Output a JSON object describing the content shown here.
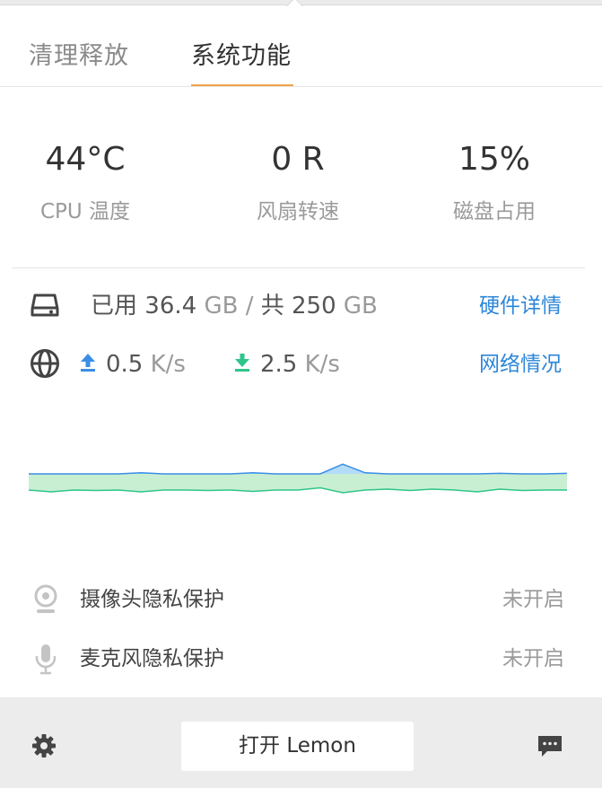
{
  "tabs": [
    {
      "label": "清理释放",
      "active": false
    },
    {
      "label": "系统功能",
      "active": true
    }
  ],
  "stats": [
    {
      "value": "44°C",
      "label": "CPU 温度"
    },
    {
      "value": "0 R",
      "label": "风扇转速"
    },
    {
      "value": "15%",
      "label": "磁盘占用"
    }
  ],
  "disk": {
    "icon": "disk-icon",
    "used_prefix": "已用",
    "used_value": "36.4",
    "unit": "GB",
    "separator": "/",
    "total_prefix": "共",
    "total_value": "250",
    "link": "硬件详情"
  },
  "network": {
    "icon": "globe-icon",
    "upload_value": "0.5",
    "upload_unit": "K/s",
    "download_value": "2.5",
    "download_unit": "K/s",
    "link": "网络情况"
  },
  "chart_data": {
    "type": "area",
    "series": [
      {
        "values": [
          0,
          0,
          0,
          0,
          0,
          0.1,
          0,
          0,
          0,
          0,
          0.1,
          0,
          0,
          0,
          0.9,
          0.1,
          0,
          0,
          0,
          0,
          0,
          0.05,
          0,
          0,
          0.05
        ]
      },
      {
        "values": [
          0.3,
          0.5,
          0.3,
          0.35,
          0.3,
          0.5,
          0.3,
          0.3,
          0.35,
          0.3,
          0.45,
          0.3,
          0.3,
          0.05,
          0.6,
          0.3,
          0.2,
          0.35,
          0.2,
          0.3,
          0.5,
          0.2,
          0.35,
          0.3,
          0.3
        ]
      }
    ]
  },
  "privacy": [
    {
      "icon": "camera-icon",
      "label": "摄像头隐私保护",
      "status": "未开启"
    },
    {
      "icon": "microphone-icon",
      "label": "麦克风隐私保护",
      "status": "未开启"
    }
  ],
  "footer": {
    "settings_icon": "gear-icon",
    "open_button": "打开 Lemon",
    "feedback_icon": "message-icon"
  },
  "colors": {
    "accent": "#f0a247",
    "link": "#2d86d8",
    "upload": "#3a8ee6",
    "download": "#2fc58a",
    "area_blue": "#b3dcf8",
    "area_green": "#c9efd2"
  }
}
